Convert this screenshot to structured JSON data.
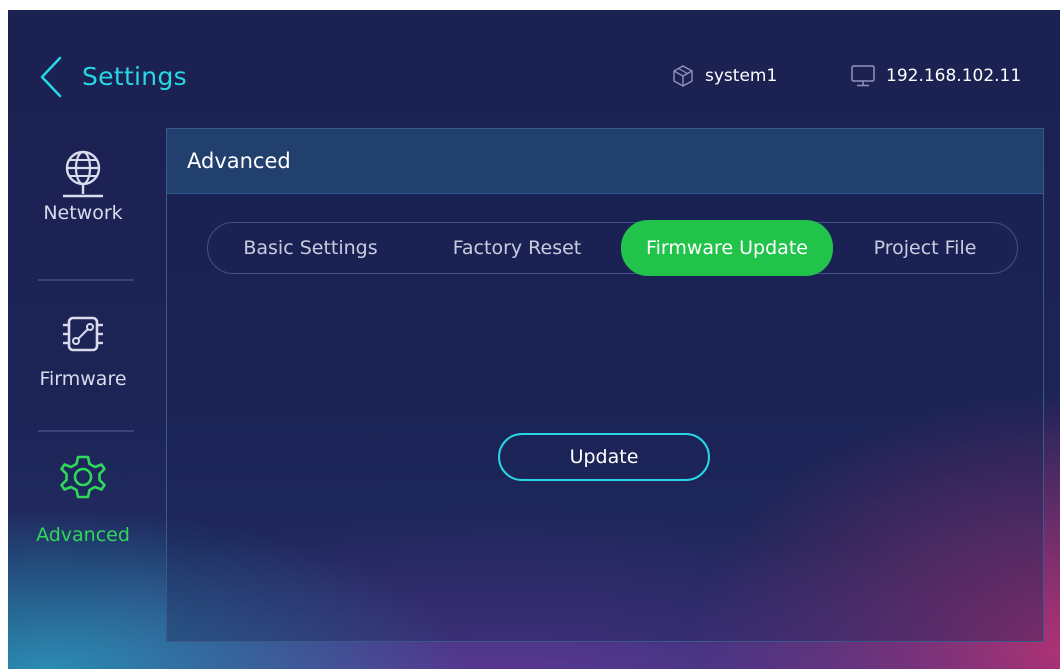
{
  "header": {
    "title": "Settings",
    "system_name": "system1",
    "ip_address": "192.168.102.11"
  },
  "sidebar": {
    "items": [
      {
        "label": "Network",
        "icon": "globe-network-icon",
        "active": false
      },
      {
        "label": "Firmware",
        "icon": "chip-icon",
        "active": false
      },
      {
        "label": "Advanced",
        "icon": "gear-icon",
        "active": true
      }
    ]
  },
  "panel": {
    "title": "Advanced",
    "tabs": [
      {
        "label": "Basic Settings",
        "active": false
      },
      {
        "label": "Factory Reset",
        "active": false
      },
      {
        "label": "Firmware Update",
        "active": true
      },
      {
        "label": "Project File",
        "active": false
      }
    ],
    "update_button": "Update"
  },
  "colors": {
    "accent_cyan": "#27d7e3",
    "active_green": "#21c34b",
    "background": "#1b2151",
    "panel_header": "#22406e"
  }
}
